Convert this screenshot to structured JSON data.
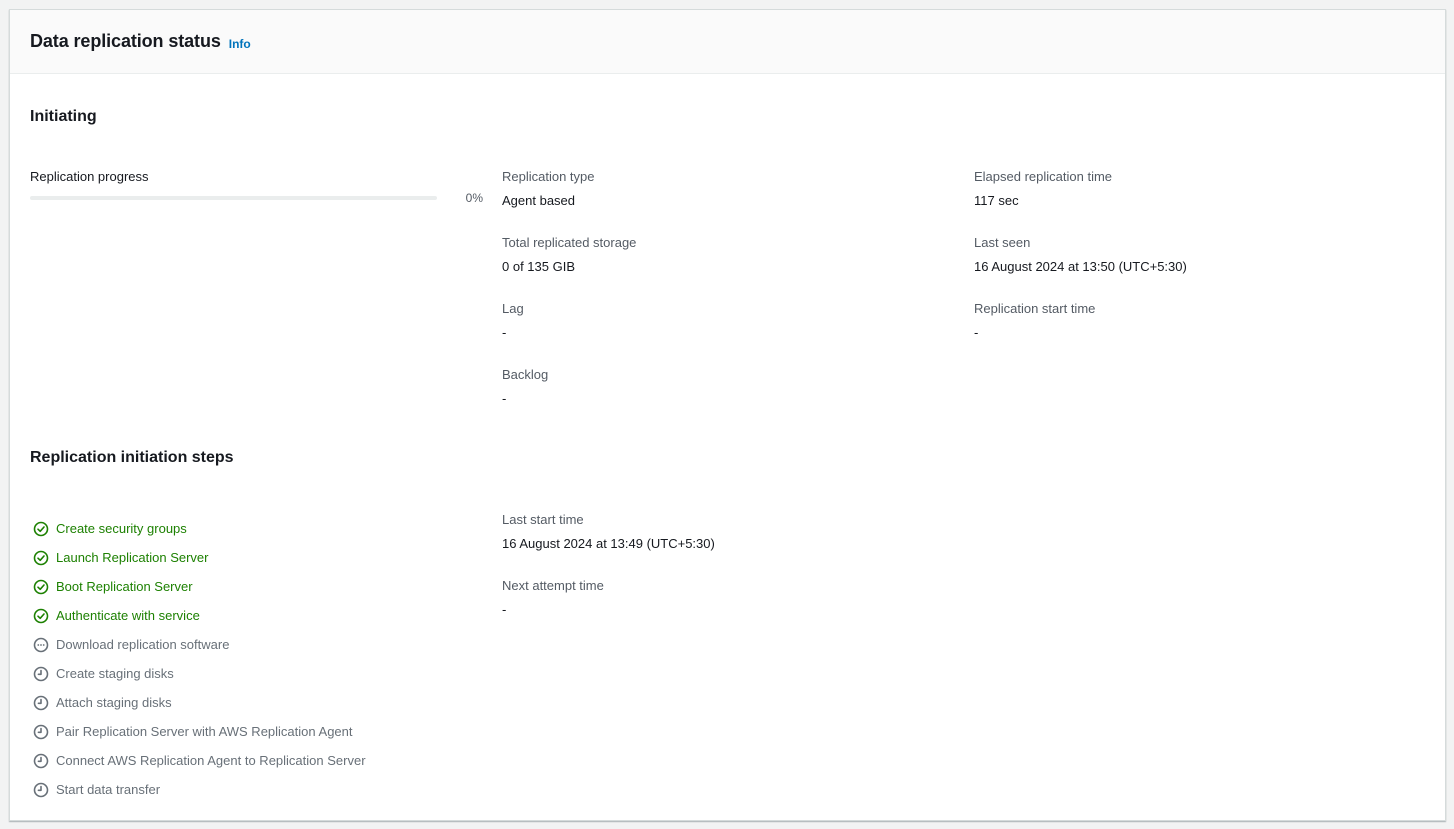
{
  "panel": {
    "title": "Data replication status",
    "info_label": "Info"
  },
  "status": {
    "heading": "Initiating"
  },
  "progress": {
    "label": "Replication progress",
    "percent_text": "0%",
    "value": 0
  },
  "details": {
    "replication_type": {
      "label": "Replication type",
      "value": "Agent based"
    },
    "total_storage": {
      "label": "Total replicated storage",
      "value": "0 of 135 GIB"
    },
    "lag": {
      "label": "Lag",
      "value": "-"
    },
    "backlog": {
      "label": "Backlog",
      "value": "-"
    },
    "elapsed_time": {
      "label": "Elapsed replication time",
      "value": "117 sec"
    },
    "last_seen": {
      "label": "Last seen",
      "value": "16 August 2024 at 13:50 (UTC+5:30)"
    },
    "start_time": {
      "label": "Replication start time",
      "value": "-"
    }
  },
  "steps_section": {
    "heading": "Replication initiation steps",
    "steps": [
      {
        "label": "Create security groups",
        "status": "done",
        "icon": "check-circle-icon"
      },
      {
        "label": "Launch Replication Server",
        "status": "done",
        "icon": "check-circle-icon"
      },
      {
        "label": "Boot Replication Server",
        "status": "done",
        "icon": "check-circle-icon"
      },
      {
        "label": "Authenticate with service",
        "status": "done",
        "icon": "check-circle-icon"
      },
      {
        "label": "Download replication software",
        "status": "in-progress",
        "icon": "ellipsis-circle-icon"
      },
      {
        "label": "Create staging disks",
        "status": "pending",
        "icon": "clock-icon"
      },
      {
        "label": "Attach staging disks",
        "status": "pending",
        "icon": "clock-icon"
      },
      {
        "label": "Pair Replication Server with AWS Replication Agent",
        "status": "pending",
        "icon": "clock-icon"
      },
      {
        "label": "Connect AWS Replication Agent to Replication Server",
        "status": "pending",
        "icon": "clock-icon"
      },
      {
        "label": "Start data transfer",
        "status": "pending",
        "icon": "clock-icon"
      }
    ],
    "last_start_time": {
      "label": "Last start time",
      "value": "16 August 2024 at 13:49 (UTC+5:30)"
    },
    "next_attempt_time": {
      "label": "Next attempt time",
      "value": "-"
    }
  },
  "colors": {
    "success": "#1d8102",
    "pending": "#687078",
    "link": "#0073bb"
  }
}
